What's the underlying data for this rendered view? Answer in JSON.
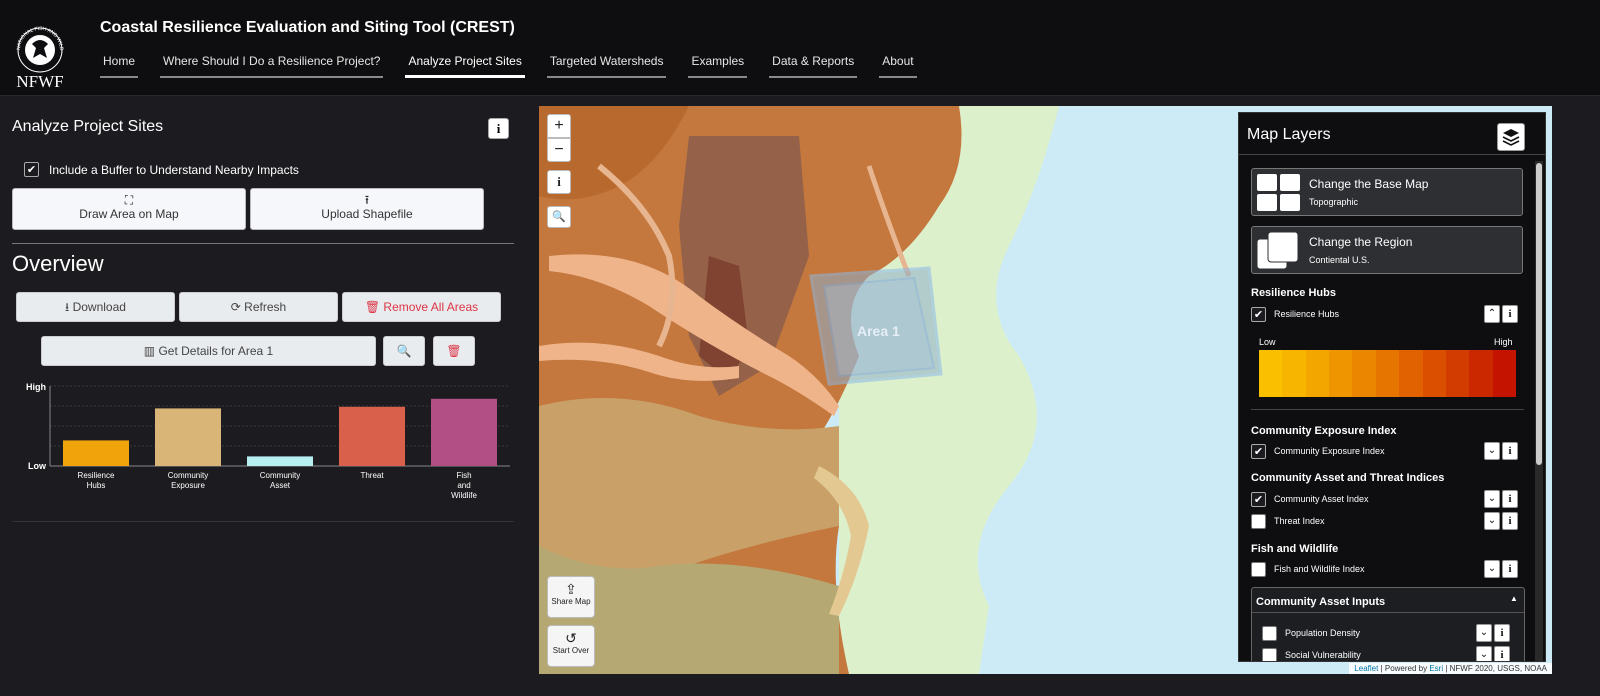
{
  "header": {
    "title": "Coastal Resilience Evaluation and Siting Tool (CREST)",
    "logo_text": "NFWF",
    "logo_ring_text": "NATIONAL FISH AND WILDLIFE FOUNDATION",
    "nav": [
      {
        "label": "Home",
        "active": false
      },
      {
        "label": "Where Should I Do a Resilience Project?",
        "active": false
      },
      {
        "label": "Analyze Project Sites",
        "active": true
      },
      {
        "label": "Targeted Watersheds",
        "active": false
      },
      {
        "label": "Examples",
        "active": false
      },
      {
        "label": "Data & Reports",
        "active": false
      },
      {
        "label": "About",
        "active": false
      }
    ]
  },
  "left_panel": {
    "title": "Analyze Project Sites",
    "info_icon": "i",
    "buffer_label": "Include a Buffer to Understand Nearby Impacts",
    "buffer_checked": true,
    "draw_label": "Draw Area on Map",
    "upload_label": "Upload Shapefile",
    "overview_title": "Overview",
    "download_label": "Download",
    "refresh_label": "Refresh",
    "remove_label": "Remove All Areas",
    "details_label": "Get Details for Area 1"
  },
  "chart_data": {
    "type": "bar",
    "categories": [
      [
        "Resilience",
        "Hubs"
      ],
      [
        "Community",
        "Exposure"
      ],
      [
        "Community",
        "Asset"
      ],
      [
        "Threat"
      ],
      [
        "Fish",
        "and",
        "Wildlife"
      ]
    ],
    "values": [
      0.32,
      0.72,
      0.12,
      0.74,
      0.84
    ],
    "colors": [
      "#f0a30a",
      "#d9b577",
      "#b7eef0",
      "#d9604a",
      "#b25086"
    ],
    "ylim": [
      0,
      1
    ],
    "ytick_labels": [
      "Low",
      "High"
    ],
    "grid": true
  },
  "map": {
    "zoom_in": "+",
    "zoom_out": "−",
    "info_icon": "i",
    "search_icon": "🔍",
    "area_label": "Area 1",
    "share_label": "Share Map",
    "start_over_label": "Start Over",
    "attribution": {
      "leaflet": "Leaflet",
      "powered": " | Powered by ",
      "esri": "Esri",
      "rest": " | NFWF 2020, USGS, NOAA"
    }
  },
  "layers": {
    "title": "Map Layers",
    "basemap": {
      "title": "Change the Base Map",
      "subtitle": "Topographic"
    },
    "region": {
      "title": "Change the Region",
      "subtitle": "Contiental U.S."
    },
    "resilience_hubs": {
      "section": "Resilience Hubs",
      "label": "Resilience Hubs",
      "checked": true,
      "low": "Low",
      "high": "High",
      "ramp": [
        "#fac000",
        "#f7b500",
        "#f3a500",
        "#ef9500",
        "#eb8600",
        "#e67500",
        "#e06200",
        "#da5000",
        "#d33c00",
        "#cc2800",
        "#c41400"
      ]
    },
    "community_exposure": {
      "section": "Community Exposure Index",
      "label": "Community Exposure Index",
      "checked": true
    },
    "asset_threat": {
      "section": "Community Asset and Threat Indices",
      "asset_label": "Community Asset Index",
      "asset_checked": true,
      "threat_label": "Threat Index",
      "threat_checked": false
    },
    "fish_wildlife": {
      "section": "Fish and Wildlife",
      "label": "Fish and Wildlife Index",
      "checked": false
    },
    "asset_inputs": {
      "section": "Community Asset Inputs",
      "items": [
        {
          "label": "Population Density",
          "checked": false
        },
        {
          "label": "Social Vulnerability",
          "checked": false
        }
      ]
    }
  }
}
